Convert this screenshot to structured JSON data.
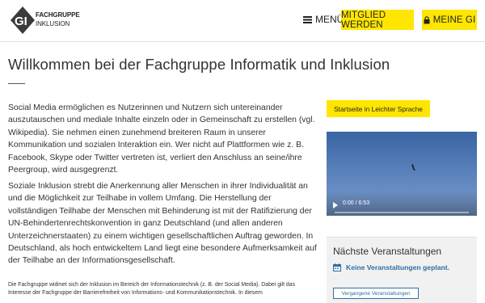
{
  "header": {
    "logo_line1": "FACHGRUPPE",
    "logo_line2": "INKLUSION",
    "menu_label": "MENÜ",
    "member_button": "MITGLIED WERDEN",
    "meine_button": "MEINE GI"
  },
  "main": {
    "title": "Willkommen bei der Fachgruppe Informatik und Inklusion",
    "paragraph1": "Social Media ermöglichen es Nutzerinnen und Nutzern sich untereinander auszutauschen und mediale Inhalte einzeln oder in Gemeinschaft zu erstellen (vgl. Wikipedia). Sie nehmen einen zunehmend breiteren Raum in unserer Kommunikation und sozialen Interaktion ein. Wer nicht auf Plattformen wie z. B. Facebook, Skype oder Twitter vertreten ist, verliert den Anschluss an seine/ihre Peergroup, wird ausgegrenzt.",
    "paragraph2": "Soziale Inklusion strebt die Anerkennung aller Menschen in ihrer Individualität an und die Möglichkeit zur Teilhabe in vollem Umfang. Die Herstellung der vollständigen Teilhabe der Menschen mit Behinderung ist mit der Ratifizierung der UN-Behindertenrechtskonvention in ganz Deutschland (und allen anderen Unterzeichnerstaaten) zu einem wichtigen gesellschaftlichen Auftrag geworden. In Deutschland, als hoch entwickeltem Land liegt eine besondere Aufmerksamkeit auf der Teilhabe an der Informationsgesellschaft.",
    "small_text": "Die Fachgruppe widmet sich der Inklusion im Bereich der Informationstechnik (z. B. der Social Media). Dabei gilt das Interesse der Fachgruppe der Barrierefreiheit von Informations- und Kommunikationstechnik. In diesem"
  },
  "sidebar": {
    "easy_language_button": "Startseite in Leichter Sprache",
    "video_time": "0:00 / 6:53",
    "events_title": "Nächste Veranstaltungen",
    "events_none": "Keine Veranstaltungen geplant.",
    "past_events_button": "Vergangene Veranstaltungen"
  },
  "colors": {
    "accent_yellow": "#ffe600",
    "link_blue": "#2f6fa3"
  },
  "icons": [
    "gi-logo",
    "menu-icon",
    "lock-icon",
    "calendar-icon",
    "play-icon"
  ]
}
